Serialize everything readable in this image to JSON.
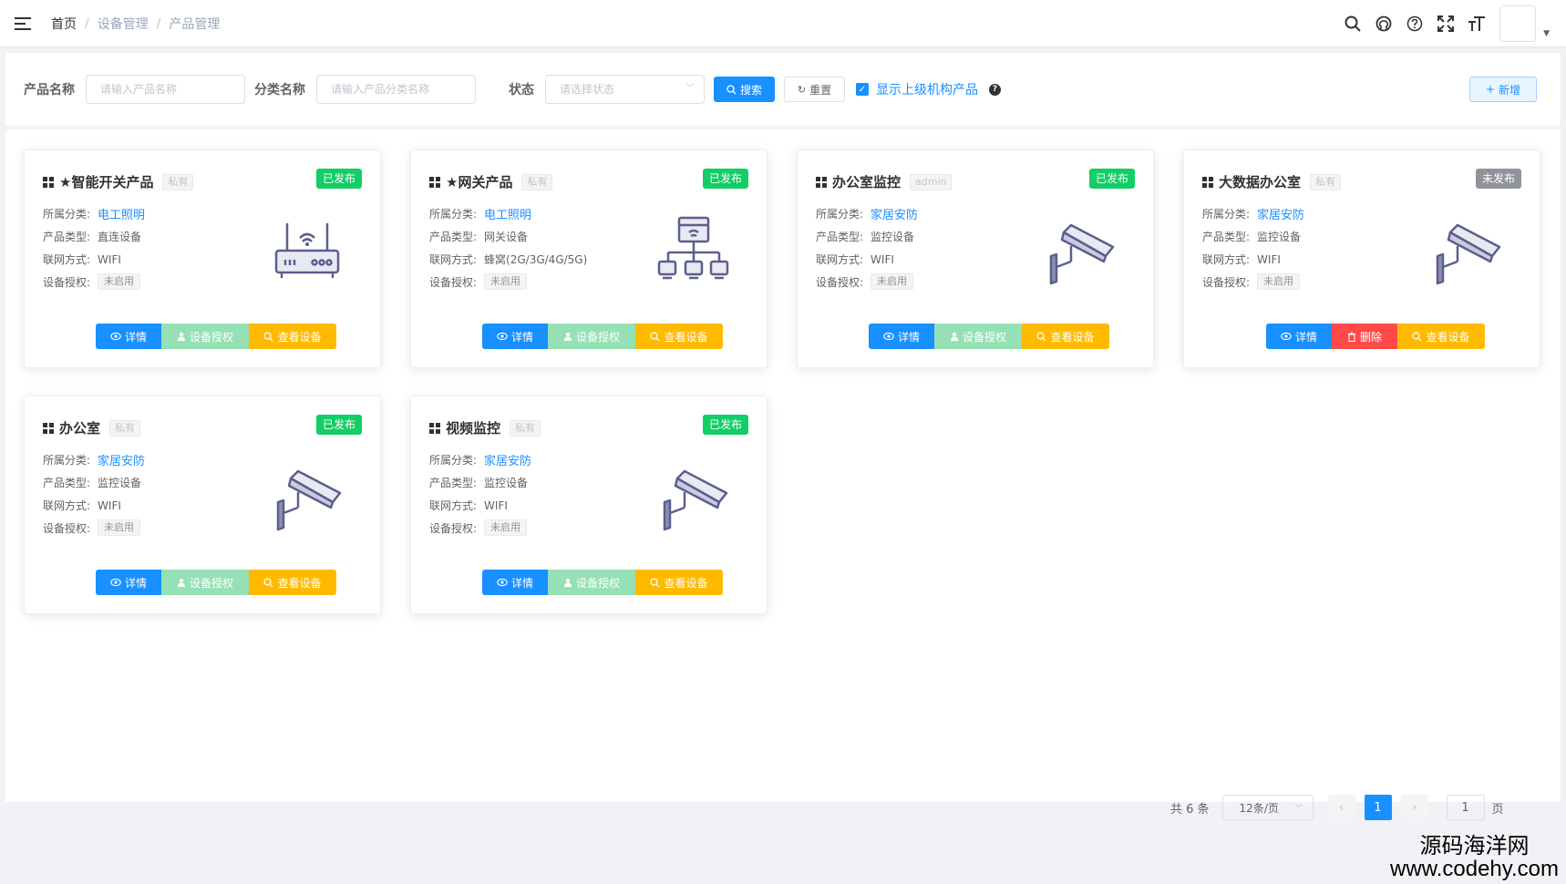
{
  "breadcrumb": {
    "home": "首页",
    "level2": "设备管理",
    "level3": "产品管理"
  },
  "nav_icons": [
    "search-icon",
    "github-icon",
    "help-icon",
    "fullscreen-icon",
    "font-size-icon"
  ],
  "search": {
    "product_name_label": "产品名称",
    "product_name_placeholder": "请输入产品名称",
    "category_label": "分类名称",
    "category_placeholder": "请输入产品分类名称",
    "status_label": "状态",
    "status_placeholder": "请选择状态",
    "search_btn": "搜索",
    "reset_btn": "重置",
    "show_parent_label": "显示上级机构产品",
    "add_btn": "新增"
  },
  "labels": {
    "category": "所属分类:",
    "type": "产品类型:",
    "network": "联网方式:",
    "auth": "设备授权:"
  },
  "buttons": {
    "detail": "详情",
    "auth": "设备授权",
    "delete": "删除",
    "view": "查看设备"
  },
  "cards": [
    {
      "title": "★智能开关产品",
      "owner": "私有",
      "status": "已发布",
      "category": "电工照明",
      "type": "直连设备",
      "network": "WIFI",
      "auth": "未启用",
      "image": "router"
    },
    {
      "title": "★网关产品",
      "owner": "私有",
      "status": "已发布",
      "category": "电工照明",
      "type": "网关设备",
      "network": "蜂窝(2G/3G/4G/5G)",
      "auth": "未启用",
      "image": "gateway"
    },
    {
      "title": "办公室监控",
      "owner": "admin",
      "status": "已发布",
      "category": "家居安防",
      "type": "监控设备",
      "network": "WIFI",
      "auth": "未启用",
      "image": "camera"
    },
    {
      "title": "大数据办公室",
      "owner": "私有",
      "status": "未发布",
      "category": "家居安防",
      "type": "监控设备",
      "network": "WIFI",
      "auth": "未启用",
      "image": "camera"
    },
    {
      "title": "办公室",
      "owner": "私有",
      "status": "已发布",
      "category": "家居安防",
      "type": "监控设备",
      "network": "WIFI",
      "auth": "未启用",
      "image": "camera"
    },
    {
      "title": "视频监控",
      "owner": "私有",
      "status": "已发布",
      "category": "家居安防",
      "type": "监控设备",
      "network": "WIFI",
      "auth": "未启用",
      "image": "camera"
    }
  ],
  "pagination": {
    "total": "共 6 条",
    "page_size": "12条/页",
    "current": "1",
    "jump_value": "1",
    "page_suffix": "页"
  },
  "watermark": {
    "line1": "源码海洋网",
    "line2": "www.codehy.com"
  },
  "colors": {
    "primary": "#1890ff",
    "success": "#13ce66",
    "danger": "#ff4949",
    "warning": "#ffba00",
    "info": "#909399"
  }
}
